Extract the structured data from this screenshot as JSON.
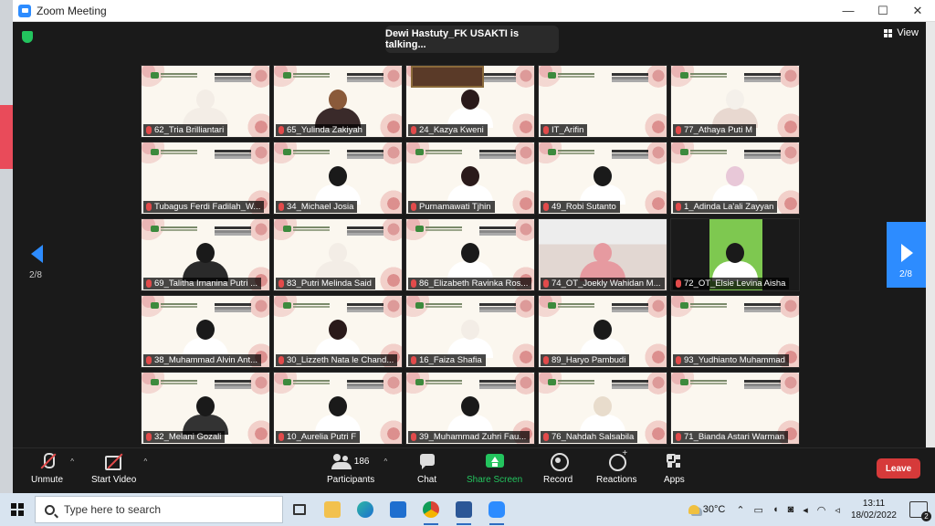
{
  "window": {
    "title": "Zoom Meeting",
    "minimize": "—",
    "maximize": "☐",
    "close": "✕"
  },
  "meeting": {
    "talking_banner": "Dewi Hastuty_FK USAKTI is talking...",
    "view_label": "View",
    "page_indicator_prev": "2/8",
    "page_indicator_next": "2/8",
    "participants": [
      {
        "name": "62_Tria Brilliantari"
      },
      {
        "name": "65_Yulinda Zakiyah"
      },
      {
        "name": "24_Kazya Kweni"
      },
      {
        "name": "IT_Arifin"
      },
      {
        "name": "77_Athaya Puti M"
      },
      {
        "name": "Tubagus Ferdi Fadilah_W..."
      },
      {
        "name": "34_Michael Josia"
      },
      {
        "name": "Purnamawati Tjhin"
      },
      {
        "name": "49_Robi Sutanto"
      },
      {
        "name": "1_Adinda La'ali Zayyan"
      },
      {
        "name": "69_Talitha Irnanina Putri ..."
      },
      {
        "name": "83_Putri Melinda Said"
      },
      {
        "name": "86_Elizabeth Ravinka Ros..."
      },
      {
        "name": "74_OT_Joekly Wahidan M..."
      },
      {
        "name": "72_OT_Elsie Levina Aisha"
      },
      {
        "name": "38_Muhammad Alvin Ant..."
      },
      {
        "name": "30_Lizzeth Nata le Chand..."
      },
      {
        "name": "16_Faiza Shafia"
      },
      {
        "name": "89_Haryo Pambudi"
      },
      {
        "name": "93_Yudhianto Muhammad"
      },
      {
        "name": "32_Melani Gozali"
      },
      {
        "name": "10_Aurelia Putri F"
      },
      {
        "name": "39_Muhammad Zuhri Fau..."
      },
      {
        "name": "76_Nahdah Salsabila"
      },
      {
        "name": "71_Bianda Astari Warman"
      }
    ]
  },
  "toolbar": {
    "unmute": "Unmute",
    "start_video": "Start Video",
    "participants_label": "Participants",
    "participants_count": "186",
    "chat": "Chat",
    "share_screen": "Share Screen",
    "record": "Record",
    "reactions": "Reactions",
    "apps": "Apps",
    "leave": "Leave"
  },
  "taskbar": {
    "search_placeholder": "Type here to search",
    "temperature": "30°C",
    "time": "13:11",
    "date": "18/02/2022",
    "notifications": "2"
  }
}
